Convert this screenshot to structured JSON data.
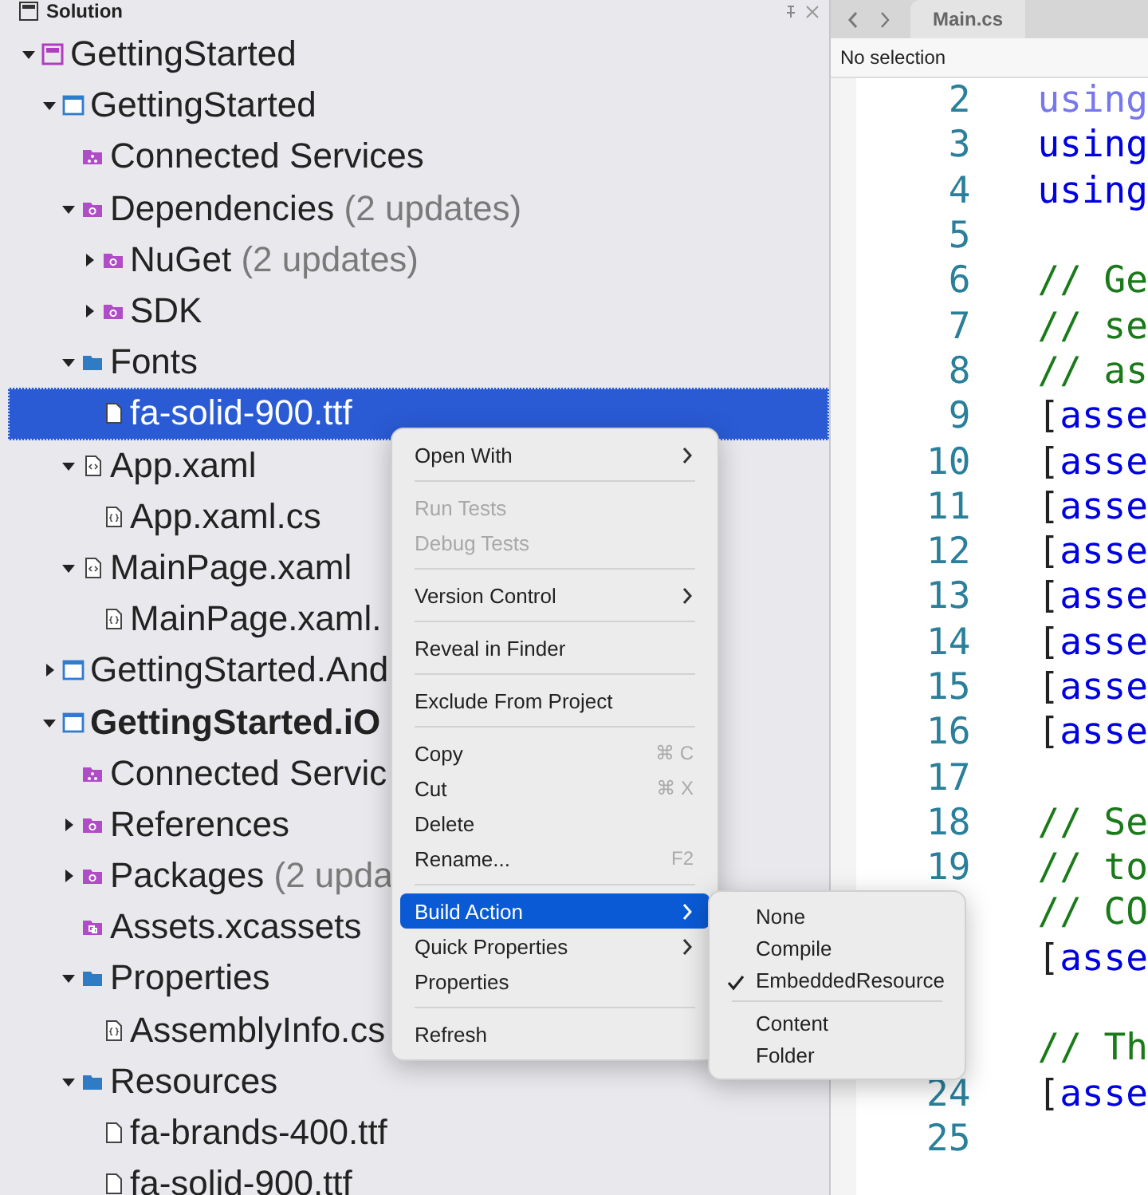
{
  "solution_panel": {
    "title": "Solution",
    "tree": [
      {
        "label": "GettingStarted",
        "kind": "solution",
        "expanded": true,
        "children": [
          {
            "label": "GettingStarted",
            "kind": "project",
            "expanded": true,
            "children": [
              {
                "label": "Connected Services",
                "kind": "services"
              },
              {
                "label": "Dependencies",
                "note": "(2 updates)",
                "kind": "package",
                "expanded": true,
                "children": [
                  {
                    "label": "NuGet",
                    "note": "(2 updates)",
                    "kind": "package",
                    "expanded": false
                  },
                  {
                    "label": "SDK",
                    "kind": "package",
                    "expanded": false
                  }
                ]
              },
              {
                "label": "Fonts",
                "kind": "folder",
                "expanded": true,
                "children": [
                  {
                    "label": "fa-solid-900.ttf",
                    "kind": "file",
                    "selected": true
                  }
                ]
              },
              {
                "label": "App.xaml",
                "kind": "xaml",
                "expanded": true,
                "children": [
                  {
                    "label": "App.xaml.cs",
                    "kind": "cs"
                  }
                ]
              },
              {
                "label": "MainPage.xaml",
                "kind": "xaml",
                "expanded": true,
                "children": [
                  {
                    "label": "MainPage.xaml.",
                    "kind": "cs"
                  }
                ]
              }
            ]
          },
          {
            "label": "GettingStarted.And",
            "kind": "project",
            "expanded": false
          },
          {
            "label": "GettingStarted.iO",
            "kind": "project",
            "startup": true,
            "expanded": true,
            "children": [
              {
                "label": "Connected Servic",
                "kind": "services"
              },
              {
                "label": "References",
                "kind": "package",
                "expanded": false
              },
              {
                "label": "Packages",
                "note": "(2 upda",
                "kind": "package",
                "expanded": false
              },
              {
                "label": "Assets.xcassets",
                "kind": "assets"
              },
              {
                "label": "Properties",
                "kind": "folder",
                "expanded": true,
                "children": [
                  {
                    "label": "AssemblyInfo.cs",
                    "kind": "cs"
                  }
                ]
              },
              {
                "label": "Resources",
                "kind": "folder",
                "expanded": true,
                "children": [
                  {
                    "label": "fa-brands-400.ttf",
                    "kind": "file"
                  },
                  {
                    "label": "fa-solid-900.ttf",
                    "kind": "file"
                  }
                ]
              }
            ]
          }
        ]
      }
    ]
  },
  "editor": {
    "tab": "Main.cs",
    "breadcrumb": "No selection",
    "lines": [
      {
        "number": "2",
        "tokens": [
          {
            "text": "using",
            "kind": "faded"
          }
        ]
      },
      {
        "number": "3",
        "tokens": [
          {
            "text": "using",
            "kind": "keyword"
          }
        ]
      },
      {
        "number": "4",
        "tokens": [
          {
            "text": "using",
            "kind": "keyword"
          }
        ]
      },
      {
        "number": "5"
      },
      {
        "number": "6",
        "tokens": [
          {
            "text": "// Ge",
            "kind": "comment"
          }
        ]
      },
      {
        "number": "7",
        "tokens": [
          {
            "text": "// se",
            "kind": "comment"
          }
        ]
      },
      {
        "number": "8",
        "tokens": [
          {
            "text": "// as",
            "kind": "comment"
          }
        ]
      },
      {
        "number": "9",
        "tokens": [
          {
            "text": "[",
            "kind": "plain"
          },
          {
            "text": "asse",
            "kind": "keyword"
          }
        ]
      },
      {
        "number": "10",
        "tokens": [
          {
            "text": "[",
            "kind": "plain"
          },
          {
            "text": "asse",
            "kind": "keyword"
          }
        ]
      },
      {
        "number": "11",
        "tokens": [
          {
            "text": "[",
            "kind": "plain"
          },
          {
            "text": "asse",
            "kind": "keyword"
          }
        ]
      },
      {
        "number": "12",
        "tokens": [
          {
            "text": "[",
            "kind": "plain"
          },
          {
            "text": "asse",
            "kind": "keyword"
          }
        ]
      },
      {
        "number": "13",
        "tokens": [
          {
            "text": "[",
            "kind": "plain"
          },
          {
            "text": "asse",
            "kind": "keyword"
          }
        ]
      },
      {
        "number": "14",
        "tokens": [
          {
            "text": "[",
            "kind": "plain"
          },
          {
            "text": "asse",
            "kind": "keyword"
          }
        ]
      },
      {
        "number": "15",
        "tokens": [
          {
            "text": "[",
            "kind": "plain"
          },
          {
            "text": "asse",
            "kind": "keyword"
          }
        ]
      },
      {
        "number": "16",
        "tokens": [
          {
            "text": "[",
            "kind": "plain"
          },
          {
            "text": "asse",
            "kind": "keyword"
          }
        ]
      },
      {
        "number": "17"
      },
      {
        "number": "18",
        "tokens": [
          {
            "text": "// Se",
            "kind": "comment"
          }
        ]
      },
      {
        "number": "19",
        "tokens": [
          {
            "text": "// to",
            "kind": "comment"
          }
        ]
      },
      {
        "tokens": [
          {
            "text": "// CO",
            "kind": "comment"
          }
        ]
      },
      {
        "tokens": [
          {
            "text": "[",
            "kind": "plain"
          },
          {
            "text": "asse",
            "kind": "keyword"
          }
        ]
      },
      {
        "blank": true
      },
      {
        "tokens": [
          {
            "text": "// Th",
            "kind": "comment"
          }
        ]
      },
      {
        "number": "24",
        "tokens": [
          {
            "text": "[",
            "kind": "plain"
          },
          {
            "text": "asse",
            "kind": "keyword"
          }
        ]
      },
      {
        "number": "25"
      }
    ]
  },
  "context_menu": {
    "groups": [
      [
        {
          "label": "Open With",
          "submenu": true,
          "disabled": false
        }
      ],
      [
        {
          "label": "Run Tests",
          "disabled": true
        },
        {
          "label": "Debug Tests",
          "disabled": true
        }
      ],
      [
        {
          "label": "Version Control",
          "submenu": true,
          "disabled": false
        }
      ],
      [
        {
          "label": "Reveal in Finder",
          "disabled": false
        }
      ],
      [
        {
          "label": "Exclude From Project",
          "disabled": false
        }
      ],
      [
        {
          "label": "Copy",
          "shortcut": "⌘ C",
          "disabled": false
        },
        {
          "label": "Cut",
          "shortcut": "⌘ X",
          "disabled": false
        },
        {
          "label": "Delete",
          "disabled": false
        },
        {
          "label": "Rename...",
          "shortcut": "F2",
          "disabled": false
        }
      ],
      [
        {
          "label": "Build Action",
          "submenu": true,
          "selected": true,
          "disabled": false
        },
        {
          "label": "Quick Properties",
          "submenu": true,
          "disabled": false
        },
        {
          "label": "Properties",
          "disabled": false
        }
      ],
      [
        {
          "label": "Refresh",
          "disabled": false
        }
      ]
    ],
    "submenu": {
      "groups": [
        [
          {
            "label": "None",
            "checked": false
          },
          {
            "label": "Compile",
            "checked": false
          },
          {
            "label": "EmbeddedResource",
            "checked": true
          }
        ],
        [
          {
            "label": "Content",
            "checked": false
          },
          {
            "label": "Folder",
            "checked": false
          }
        ]
      ]
    }
  }
}
